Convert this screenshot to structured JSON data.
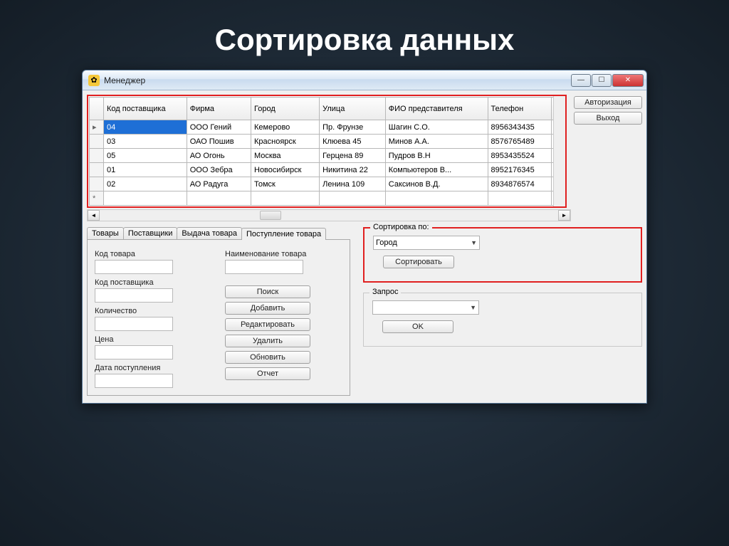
{
  "slide_title": "Сортировка данных",
  "window": {
    "title": "Менеджер"
  },
  "side_buttons": {
    "auth": "Авторизация",
    "exit": "Выход"
  },
  "grid": {
    "headers": [
      "Код поставщика",
      "Фирма",
      "Город",
      "Улица",
      "ФИО представителя",
      "Телефон"
    ],
    "rows": [
      {
        "selected": true,
        "cells": [
          "04",
          "ООО Гений",
          "Кемерово",
          "Пр. Фрунзе",
          "Шагин С.О.",
          "8956343435"
        ]
      },
      {
        "selected": false,
        "cells": [
          "03",
          "ОАО Пошив",
          "Красноярск",
          "Клюева 45",
          "Минов А.А.",
          "8576765489"
        ]
      },
      {
        "selected": false,
        "cells": [
          "05",
          "АО Огонь",
          "Москва",
          "Герцена 89",
          "Пудров В.Н",
          "8953435524"
        ]
      },
      {
        "selected": false,
        "cells": [
          "01",
          "ООО Зебра",
          "Новосибирск",
          "Никитина 22",
          "Компьютеров В...",
          "8952176345"
        ]
      },
      {
        "selected": false,
        "cells": [
          "02",
          "АО Радуга",
          "Томск",
          "Ленина 109",
          "Саксинов В.Д.",
          "8934876574"
        ]
      }
    ]
  },
  "tabs": {
    "items": [
      "Товары",
      "Поставщики",
      "Выдача товара",
      "Поступление товара"
    ],
    "active_index": 3
  },
  "form": {
    "left_labels": [
      "Код товара",
      "Код поставщика",
      "Количество",
      "Цена",
      "Дата поступления"
    ],
    "right_label": "Наименование товара",
    "buttons": [
      "Поиск",
      "Добавить",
      "Редактировать",
      "Удалить",
      "Обновить",
      "Отчет"
    ]
  },
  "sort_box": {
    "legend": "Сортировка по:",
    "value": "Город",
    "button": "Сортировать"
  },
  "query_box": {
    "legend": "Запрос",
    "value": "",
    "button": "OK"
  }
}
